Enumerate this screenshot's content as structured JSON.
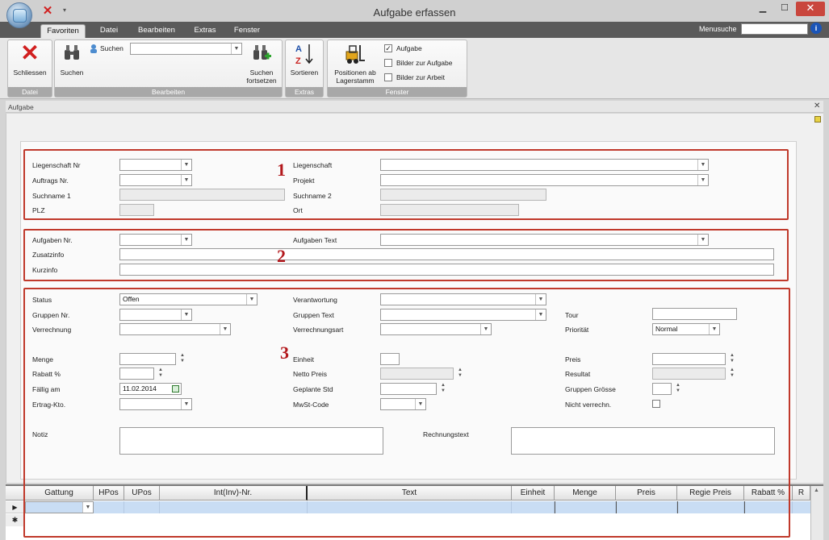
{
  "window": {
    "title": "Aufgabe erfassen",
    "min_icon": "minimize-icon",
    "max_icon": "maximize-icon",
    "close_icon": "close-icon"
  },
  "tabs": [
    "Favoriten",
    "Datei",
    "Extras",
    "Fenster",
    "Bearbeiten"
  ],
  "tab_labels": {
    "favoriten": "Favoriten",
    "datei": "Datei",
    "bearbeiten": "Bearbeiten",
    "extras": "Extras",
    "fenster": "Fenster"
  },
  "menusuche": {
    "label": "Menusuche",
    "value": ""
  },
  "ribbon": {
    "datei": {
      "group": "Datei",
      "schliessen": "Schliessen"
    },
    "bearbeiten": {
      "group": "Bearbeiten",
      "suchen_big": "Suchen",
      "suchen_small": "Suchen",
      "suchen_value": "",
      "fortsetzen_1": "Suchen",
      "fortsetzen_2": "fortsetzen"
    },
    "extras": {
      "group": "Extras",
      "sortieren": "Sortieren"
    },
    "fenster": {
      "group": "Fenster",
      "positionen_1": "Positionen ab",
      "positionen_2": "Lagerstamm",
      "checks": [
        {
          "label": "Aufgabe",
          "checked": true
        },
        {
          "label": "Bilder zur Aufgabe",
          "checked": false
        },
        {
          "label": "Bilder zur Arbeit",
          "checked": false
        }
      ]
    }
  },
  "document": {
    "title": "Aufgabe"
  },
  "annotations": {
    "one": "1",
    "two": "2",
    "three": "3"
  },
  "section1": {
    "liegenschaft_nr": "Liegenschaft Nr",
    "auftrags_nr": "Auftrags Nr.",
    "suchname1": "Suchname 1",
    "plz": "PLZ",
    "liegenschaft": "Liegenschaft",
    "projekt": "Projekt",
    "suchname2": "Suchname 2",
    "ort": "Ort"
  },
  "section2": {
    "aufgaben_nr": "Aufgaben Nr.",
    "zusatzinfo": "Zusatzinfo",
    "kurzinfo": "Kurzinfo",
    "aufgaben_text": "Aufgaben Text"
  },
  "section3": {
    "status": "Status",
    "status_value": "Offen",
    "gruppen_nr": "Gruppen Nr.",
    "verrechnung": "Verrechnung",
    "menge": "Menge",
    "rabatt": "Rabatt %",
    "faellig": "Fällig am",
    "faellig_value": "11.02.2014",
    "ertrag": "Ertrag-Kto.",
    "verantwortung": "Verantwortung",
    "gruppen_text": "Gruppen Text",
    "verrechnungsart": "Verrechnungsart",
    "einheit": "Einheit",
    "netto_preis": "Netto Preis",
    "geplante_std": "Geplante Std",
    "mwst": "MwSt-Code",
    "tour": "Tour",
    "prioritaet": "Priorität",
    "prioritaet_value": "Normal",
    "preis": "Preis",
    "resultat": "Resultat",
    "gruppen_groesse": "Gruppen Grösse",
    "nicht_verrechn": "Nicht verrechn.",
    "notiz": "Notiz",
    "rechnungstext": "Rechnungstext"
  },
  "grid": {
    "columns": [
      "Gattung",
      "HPos",
      "UPos",
      "Int(Inv)-Nr.",
      "Text",
      "Einheit",
      "Menge",
      "Preis",
      "Regie Preis",
      "Rabatt %",
      "R"
    ],
    "row_marker": "▶",
    "new_marker": "✱"
  },
  "colors": {
    "annotation_red": "#c0392b",
    "selected_row": "#c9ddf4",
    "tab_bar": "#5a5a5a"
  }
}
